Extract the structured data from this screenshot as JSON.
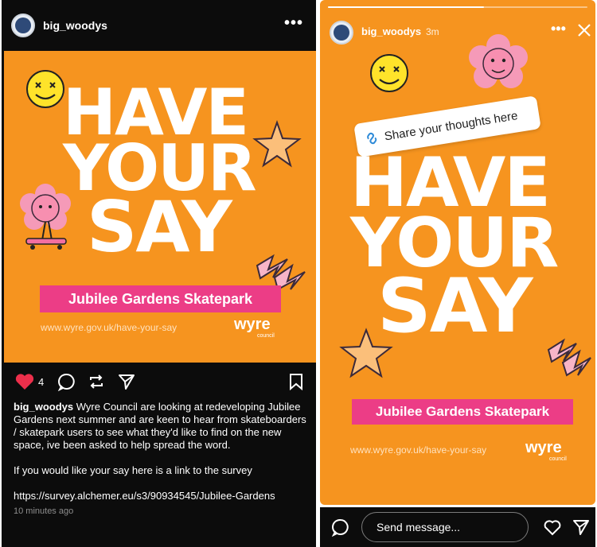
{
  "post": {
    "username": "big_woodys",
    "more_label": "•••",
    "art": {
      "headline": [
        "HAVE",
        "YOUR",
        "SAY"
      ],
      "pill": "Jubilee Gardens Skatepark",
      "url": "www.wyre.gov.uk/have-your-say",
      "logo": "wyre",
      "logo_sub": "council"
    },
    "likes": "4",
    "caption_user": "big_woodys",
    "caption_text": " Wyre Council are looking at redeveloping Jubilee Gardens next summer and are keen to hear from skateboarders / skatepark users to see what they'd like to find on the new space, ive been asked to help spread the word.",
    "caption_p2": "If you would like your say here is a link to the survey",
    "caption_link": "https://survey.alchemer.eu/s3/90934545/Jubilee-Gardens",
    "timestamp": "10 minutes ago"
  },
  "story": {
    "username": "big_woodys",
    "time": "3m",
    "more_label": "•••",
    "sticker": "Share your thoughts here",
    "art": {
      "headline": [
        "HAVE",
        "YOUR",
        "SAY"
      ],
      "pill": "Jubilee Gardens Skatepark",
      "url": "www.wyre.gov.uk/have-your-say",
      "logo": "wyre",
      "logo_sub": "council"
    },
    "send_placeholder": "Send message..."
  },
  "colors": {
    "orange": "#f6941f",
    "pink": "#ec3d86",
    "like": "#ed2f4b",
    "dark": "#0c0c0c"
  }
}
